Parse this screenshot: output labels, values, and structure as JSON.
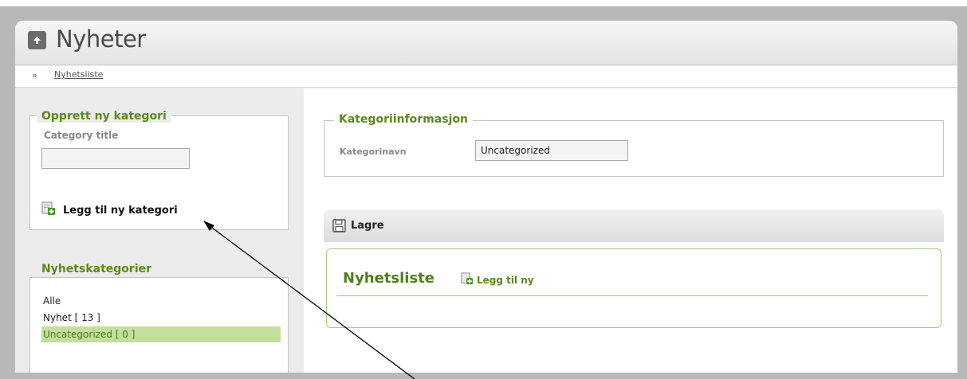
{
  "header": {
    "title": "Nyheter"
  },
  "breadcrumb": {
    "separator": "»",
    "link": "Nyhetsliste"
  },
  "create_category": {
    "legend": "Opprett ny kategori",
    "title_label": "Category title",
    "title_value": "",
    "add_label": "Legg til ny kategori"
  },
  "news_categories": {
    "legend": "Nyhetskategorier",
    "items": [
      {
        "label": "Alle",
        "selected": false
      },
      {
        "label": "Nyhet [ 13 ]",
        "selected": false
      },
      {
        "label": "Uncategorized [ 0 ]",
        "selected": true
      }
    ]
  },
  "category_info": {
    "legend": "Kategoriinformasjon",
    "name_label": "Kategorinavn",
    "name_value": "Uncategorized"
  },
  "toolbar": {
    "save_label": "Lagre"
  },
  "news_list": {
    "title": "Nyhetsliste",
    "add_label": "Legg til ny"
  },
  "icons": {
    "header": "up-arrow-icon",
    "add": "add-page-icon",
    "save": "floppy-disk-icon"
  },
  "colors": {
    "accent_green": "#5a8a1a",
    "selected_row": "#c3df9c",
    "box_border_green": "#a6cc76"
  }
}
